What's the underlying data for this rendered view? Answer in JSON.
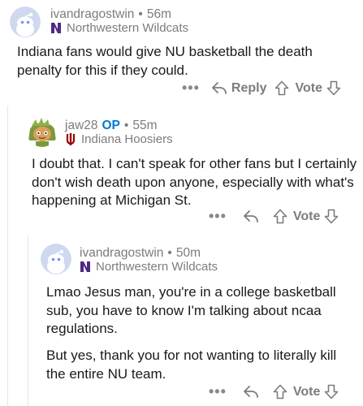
{
  "comments": [
    {
      "username": "ivandragostwin",
      "op": "",
      "age": "56m",
      "flair": "Northwestern Wildcats",
      "flair_icon": "northwestern-n-icon",
      "avatar_icon": "snoo-avatar-icon",
      "paragraphs": [
        "Indiana fans would give NU basketball the death penalty for this if they could."
      ],
      "actions": {
        "more": "•••",
        "reply": "Reply",
        "vote": "Vote"
      }
    },
    {
      "username": "jaw28",
      "op": "OP",
      "age": "55m",
      "flair": "Indiana Hoosiers",
      "flair_icon": "indiana-iu-icon",
      "avatar_icon": "snoo-hooded-avatar-icon",
      "paragraphs": [
        "I doubt that. I can't speak for other fans but I certainly don't wish death upon anyone, especially with what's happening at Michigan St."
      ],
      "actions": {
        "more": "•••",
        "reply": "",
        "vote": "Vote"
      }
    },
    {
      "username": "ivandragostwin",
      "op": "",
      "age": "50m",
      "flair": "Northwestern Wildcats",
      "flair_icon": "northwestern-n-icon",
      "avatar_icon": "snoo-avatar-icon",
      "paragraphs": [
        "Lmao Jesus man, you're in a college basketball sub, you have to know I'm talking about ncaa regulations.",
        "But yes, thank you for not wanting to literally kill the entire NU team."
      ],
      "actions": {
        "more": "•••",
        "reply": "",
        "vote": "Vote"
      }
    }
  ],
  "colors": {
    "meta": "#7c7c7c",
    "op": "#0079d3",
    "northwestern": "#4e2a84",
    "indiana": "#990000",
    "avatar_bg": "#cfd8ef",
    "thread_line": "#e6e6e6"
  }
}
